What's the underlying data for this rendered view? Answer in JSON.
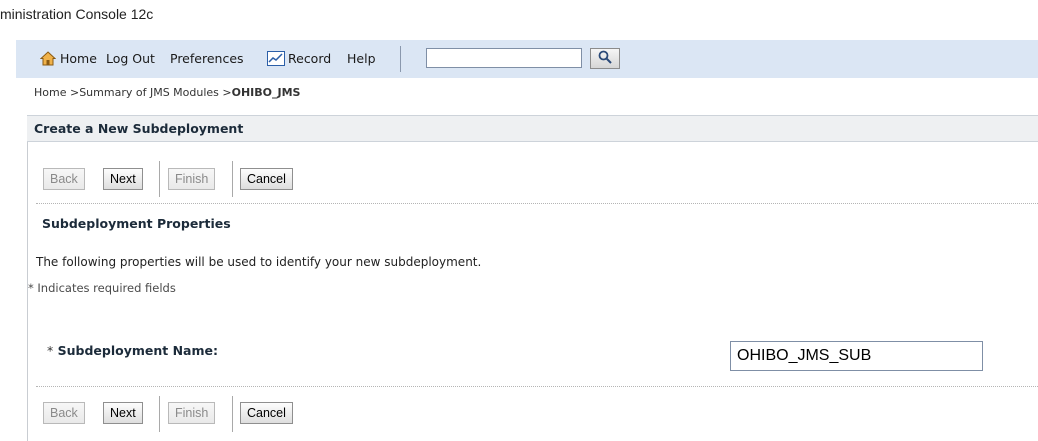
{
  "app": {
    "title": "ministration Console 12c"
  },
  "toolbar": {
    "home_label": "Home",
    "logout_label": "Log Out",
    "preferences_label": "Preferences",
    "record_label": "Record",
    "help_label": "Help",
    "search_value": ""
  },
  "breadcrumb": {
    "home": "Home",
    "summary": "Summary of JMS Modules",
    "separator": ">",
    "current": "OHIBO_JMS"
  },
  "section": {
    "title": "Create a New Subdeployment"
  },
  "buttons": {
    "back": "Back",
    "next": "Next",
    "finish": "Finish",
    "cancel": "Cancel"
  },
  "content": {
    "heading": "Subdeployment Properties",
    "description": "The following properties will be used to identify your new subdeployment.",
    "required_note": "* Indicates required fields"
  },
  "form": {
    "required_marker": "*",
    "name_label": "Subdeployment Name:",
    "name_value": "OHIBO_JMS_SUB"
  },
  "colors": {
    "toolbar_bg": "#dbe6f4",
    "header_text": "#1c2b3a"
  }
}
